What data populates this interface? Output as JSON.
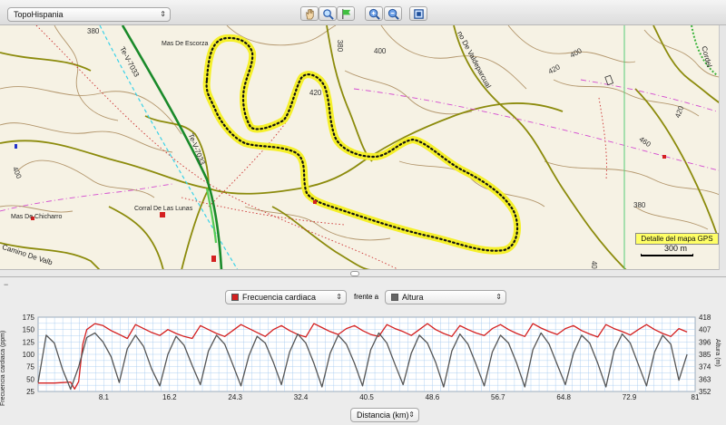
{
  "toolbar": {
    "map_source": "TopoHispania",
    "tools": [
      {
        "name": "pan-tool",
        "icon": "hand-icon"
      },
      {
        "name": "zoom-tool",
        "icon": "magnifier-icon"
      },
      {
        "name": "flag-tool",
        "icon": "flag-icon"
      },
      {
        "name": "zoom-in-button",
        "icon": "zoom-in-icon"
      },
      {
        "name": "zoom-out-button",
        "icon": "zoom-out-icon"
      },
      {
        "name": "fit-button",
        "icon": "fit-screen-icon"
      }
    ]
  },
  "map": {
    "place_labels": {
      "mas_escorza": "Mas De Escorza",
      "corral": "Corral De Las Lunas",
      "chicharro": "Mas De Chicharro"
    },
    "road_labels": {
      "tev_upper": "Te-V-7033",
      "tev_lower": "Te-V-7033",
      "valdeparcual": "no De Valdeparcual",
      "cordel": "Cordel",
      "camino": "Camino De Valb"
    },
    "contours": {
      "c380a": "380",
      "c400a": "400",
      "c420a": "420",
      "c400b": "400",
      "c420b": "420",
      "c420c": "420",
      "c460": "460",
      "c380b": "380",
      "c400c": "400",
      "c380c": "380",
      "c400d": "400"
    },
    "scale_label": "300 m",
    "detail_button": "Detalle del mapa GPS",
    "colors": {
      "background": "#f6f2e4",
      "track": "#f5f02a",
      "contour": "#a0825a",
      "track_road": "#8a8a00"
    }
  },
  "chart_panel": {
    "series_left": "Frecuencia cardiaca",
    "vs_label": "frente a",
    "series_right": "Altura",
    "x_selector": "Distancia (km)",
    "colors": {
      "left": "#d42020",
      "right": "#555555"
    }
  },
  "chart_data": {
    "type": "line",
    "xlabel": "Distancia (km)",
    "ylabel_left": "Frecuencia cardiaca (ppm)",
    "ylabel_right": "Altura (m)",
    "xlim": [
      0,
      81
    ],
    "x_ticks": [
      "8.1",
      "16.2",
      "24.3",
      "32.4",
      "40.5",
      "48.6",
      "56.7",
      "64.8",
      "72.9",
      "81"
    ],
    "y_left_ticks": [
      "25",
      "50",
      "75",
      "100",
      "125",
      "150",
      "175"
    ],
    "y_left_lim": [
      25,
      175
    ],
    "y_right_ticks": [
      "352",
      "363",
      "374",
      "385",
      "396",
      "407",
      "418"
    ],
    "y_right_lim": [
      352,
      418
    ],
    "series": [
      {
        "name": "Frecuencia cardiaca",
        "axis": "left",
        "x": [
          0,
          1,
          2,
          3,
          4,
          4.5,
          5,
          5.5,
          6,
          7,
          8,
          9,
          10,
          11,
          12,
          13,
          14,
          15,
          16,
          17,
          18,
          19,
          20,
          21,
          22,
          23,
          24,
          25,
          26,
          27,
          28,
          29,
          30,
          31,
          32,
          33,
          34,
          35,
          36,
          37,
          38,
          39,
          40,
          41,
          42,
          43,
          44,
          45,
          46,
          47,
          48,
          49,
          50,
          51,
          52,
          53,
          54,
          55,
          56,
          57,
          58,
          59,
          60,
          61,
          62,
          63,
          64,
          65,
          66,
          67,
          68,
          69,
          70,
          71,
          72,
          73,
          74,
          75,
          76,
          77,
          78,
          79,
          80
        ],
        "y": [
          42,
          42,
          42,
          43,
          44,
          30,
          45,
          120,
          150,
          162,
          158,
          148,
          140,
          132,
          160,
          152,
          144,
          138,
          150,
          142,
          136,
          132,
          158,
          150,
          142,
          136,
          148,
          160,
          152,
          144,
          136,
          150,
          158,
          148,
          140,
          135,
          162,
          154,
          146,
          140,
          152,
          158,
          148,
          140,
          136,
          160,
          152,
          146,
          138,
          150,
          162,
          150,
          142,
          136,
          158,
          150,
          143,
          138,
          152,
          160,
          150,
          142,
          136,
          162,
          153,
          146,
          140,
          152,
          158,
          148,
          141,
          135,
          160,
          152,
          146,
          139,
          150,
          160,
          150,
          142,
          136,
          152,
          145
        ]
      },
      {
        "name": "Altura",
        "axis": "right",
        "x": [
          0,
          1,
          2,
          3,
          4,
          5,
          6,
          7,
          8,
          9,
          10,
          11,
          12,
          13,
          14,
          15,
          16,
          17,
          18,
          19,
          20,
          21,
          22,
          23,
          24,
          25,
          26,
          27,
          28,
          29,
          30,
          31,
          32,
          33,
          34,
          35,
          36,
          37,
          38,
          39,
          40,
          41,
          42,
          43,
          44,
          45,
          46,
          47,
          48,
          49,
          50,
          51,
          52,
          53,
          54,
          55,
          56,
          57,
          58,
          59,
          60,
          61,
          62,
          63,
          64,
          65,
          66,
          67,
          68,
          69,
          70,
          71,
          72,
          73,
          74,
          75,
          76,
          77,
          78,
          79,
          80
        ],
        "y": [
          360,
          402,
          395,
          372,
          354,
          374,
          400,
          404,
          396,
          383,
          360,
          390,
          402,
          392,
          372,
          357,
          385,
          401,
          393,
          375,
          358,
          388,
          402,
          394,
          376,
          357,
          384,
          401,
          395,
          378,
          358,
          387,
          403,
          395,
          377,
          356,
          386,
          402,
          394,
          377,
          357,
          389,
          404,
          395,
          376,
          358,
          386,
          402,
          395,
          378,
          356,
          388,
          403,
          394,
          376,
          357,
          387,
          402,
          395,
          377,
          356,
          389,
          404,
          394,
          376,
          358,
          386,
          402,
          395,
          377,
          356,
          388,
          403,
          395,
          376,
          357,
          387,
          402,
          394,
          362,
          385
        ]
      }
    ],
    "grid": true
  }
}
